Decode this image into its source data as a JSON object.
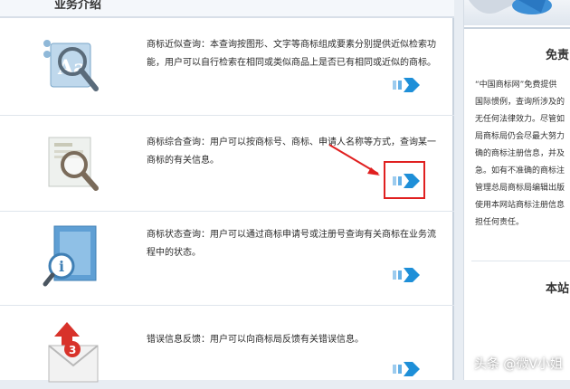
{
  "header": {
    "title_partial": "业务介绍"
  },
  "services": [
    {
      "text": "商标近似查询：本查询按图形、文字等商标组成要素分别提供近似检索功能，用户可以自行检索在相同或类似商品上是否已有相同或近似的商标。",
      "icon": "magnifier-aa-icon"
    },
    {
      "text": "商标综合查询：用户可以按商标号、商标、申请人名称等方式，查询某一商标的有关信息。",
      "icon": "magnifier-document-icon"
    },
    {
      "text": "商标状态查询：用户可以通过商标申请号或注册号查询有关商标在业务流程中的状态。",
      "icon": "info-magnifier-icon"
    },
    {
      "text": "错误信息反馈：用户可以向商标局反馈有关错误信息。",
      "icon": "envelope-alert-icon"
    }
  ],
  "sidebar": {
    "title": "免责",
    "lines": [
      "“中国商标网”免费提供",
      "国际惯例，查询所涉及的",
      "无任何法律效力。尽管如",
      "局商标局仍会尽最大努力",
      "确的商标注册信息，并及",
      "急。如有不准确的商标注",
      "管理总局商标局编辑出版",
      "使用本网站商标注册信息",
      "担任何责任。"
    ],
    "subtitle": "本站"
  },
  "watermark": "头条 @微V小姐",
  "colors": {
    "arrow": "#1e8fd8",
    "highlight": "#e02020"
  }
}
